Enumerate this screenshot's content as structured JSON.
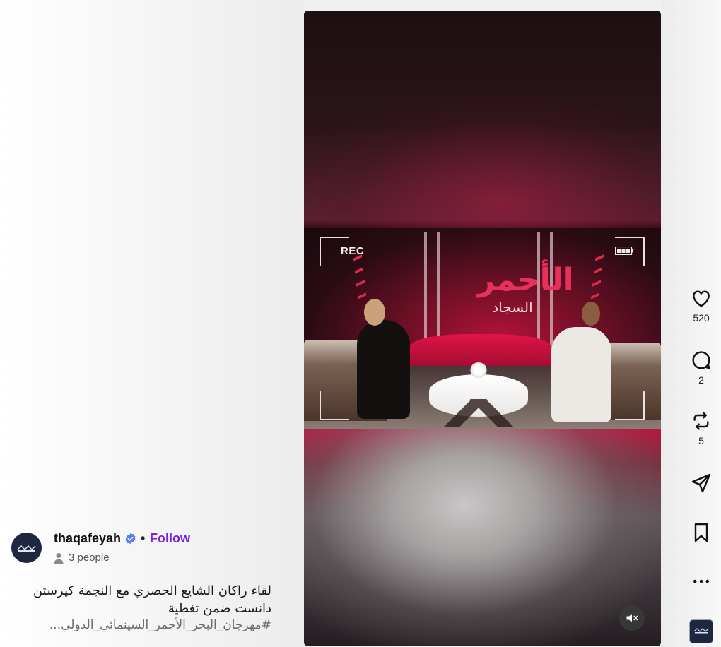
{
  "video": {
    "overlay_rec_label": "REC",
    "set_title_large": "الأحمر",
    "set_title_small": "السجاد",
    "mute_icon": "speaker-muted-icon"
  },
  "author": {
    "avatar_icon": "thaqafeyah-logo",
    "username": "thaqafeyah",
    "verified_icon": "verified-badge-icon",
    "separator": "•",
    "follow_label": "Follow",
    "people_icon": "person-icon",
    "people_label": "3 people"
  },
  "caption": {
    "text": "لقاء راكان الشايع الحصري مع النجمة كيرستن دانست ضمن تغطية",
    "hashtags": "#مهرجان_البحر_الأحمر_السينمائي_الدولي..."
  },
  "actions": {
    "like": {
      "icon": "heart-icon",
      "count": "520"
    },
    "comment": {
      "icon": "comment-bubble-icon",
      "count": "2"
    },
    "repost": {
      "icon": "repost-icon",
      "count": "5"
    },
    "share": {
      "icon": "send-icon"
    },
    "save": {
      "icon": "bookmark-icon"
    },
    "more": {
      "icon": "more-horizontal-icon"
    }
  },
  "colors": {
    "follow": "#7d1ee0",
    "verified": "#5b7cf0",
    "accent_red": "#b4123a"
  }
}
